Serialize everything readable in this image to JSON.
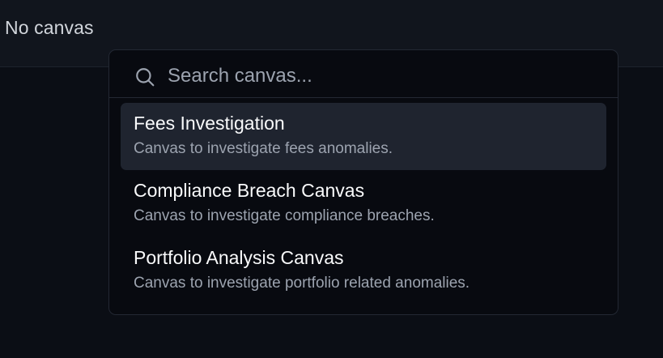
{
  "trigger": {
    "label": "No canvas"
  },
  "search": {
    "placeholder": "Search canvas...",
    "value": ""
  },
  "canvas_list": {
    "items": [
      {
        "title": "Fees Investigation",
        "description": "Canvas to investigate fees anomalies.",
        "highlighted": true
      },
      {
        "title": "Compliance Breach Canvas",
        "description": "Canvas to investigate compliance breaches.",
        "highlighted": false
      },
      {
        "title": "Portfolio Analysis Canvas",
        "description": "Canvas to investigate portfolio related anomalies.",
        "highlighted": false
      }
    ]
  },
  "colors": {
    "page_background": "#0b0e15",
    "topbar_background": "#11151d",
    "popover_background": "#080a10",
    "highlight_background": "#1f242f",
    "primary_text": "#f9fafb",
    "muted_text": "#9ca3af",
    "border": "#232833"
  },
  "icons": {
    "search": "search-icon"
  }
}
